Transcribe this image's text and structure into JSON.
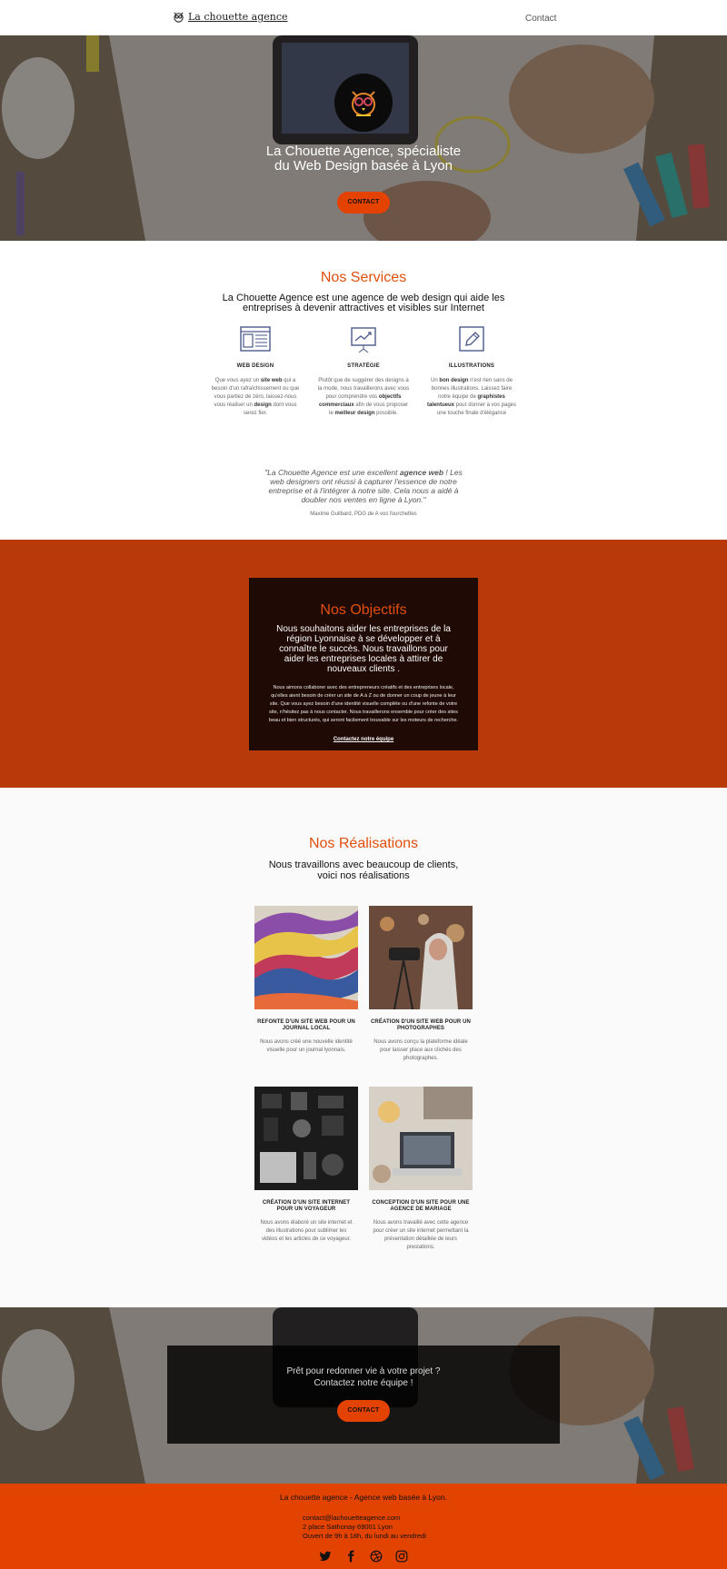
{
  "header": {
    "brand": "La chouette agence",
    "nav_contact": "Contact"
  },
  "hero": {
    "title": "La Chouette Agence, spécialiste du Web Design basée à Lyon",
    "button": "CONTACT"
  },
  "services": {
    "heading": "Nos Services",
    "lead": "La Chouette Agence est une agence de web design qui aide les entreprises à devenir attractives et visibles sur Internet",
    "items": [
      {
        "title": "WEB DESIGN",
        "icon": "web-design-icon"
      },
      {
        "title": "STRATÉGIE",
        "icon": "strategy-chart-icon"
      },
      {
        "title": "ILLUSTRATIONS",
        "icon": "pencil-icon"
      }
    ],
    "texts": {
      "web_a": "Que vous ayez un ",
      "web_b": "site web",
      "web_c": " qui a besoin d'un rafraîchissement ou que vous partiez de zéro, laissez-nous vous réaliser un ",
      "web_d": "design",
      "web_e": " dont vous serez fier.",
      "str_a": "Plutôt que de suggérer des designs à la mode, nous travaillerons avec vous pour comprendre vos ",
      "str_b": "objectifs commerciaux",
      "str_c": " afin de vous proposer le ",
      "str_d": "meilleur design",
      "str_e": " possible.",
      "ill_a": "Un ",
      "ill_b": "bon design",
      "ill_c": " n'est rien sans de bonnes illustrations. Laissez faire notre équipe de ",
      "ill_d": "graphistes talentueux",
      "ill_e": " pour donner à vos pages une touche finale d'élégance"
    }
  },
  "testimonial": {
    "q_a": "\"La Chouette Agence est une excellent ",
    "q_b": "agence web",
    "q_c": " ! Les web designers ont réussi à capturer l'essence de notre entreprise et à l'intégrer à notre site. Cela nous a aidé à doubler nos ventes en ligne à Lyon.\"",
    "author": "Maxime Guilbard, PDG de A vos fourchettes"
  },
  "objectifs": {
    "heading": "Nos Objectifs",
    "lead": "Nous souhaitons aider les entreprises de la région Lyonnaise à se développer et à connaître le succès. Nous travaillons pour aider les entreprises locales à attirer de nouveaux clients .",
    "text": "Nous aimons collaborer avec des entrepreneurs créatifs et des entreprises locale, qu'elles aient besoin de créer un site de A à Z ou de donner un coup de jeune à leur site. Que vous ayez besoin d'une identité visuelle complète ou d'une refonte de votre site, n'hésitez pas à nous contacter. Nous travaillerons ensemble pour créer des sites beau et bien structurés, qui seront facilement trouvable sur les moteurs de recherche.",
    "link": "Contactez notre équipe"
  },
  "realisations": {
    "heading": "Nos Réalisations",
    "lead": "Nous travaillons avec beaucoup de clients, voici nos réalisations",
    "projects": [
      {
        "title": "REFONTE D'UN SITE WEB POUR UN JOURNAL LOCAL",
        "text": "Nous avons créé une nouvelle identité visuelle pour un journal lyonnais."
      },
      {
        "title": "CRÉATION D'UN SITE WEB POUR UN PHOTOGRAPHES",
        "text": "Nous avons conçu la plateforme idéale pour laisser place aux clichés des photographes."
      },
      {
        "title": "CRÉATION D'UN SITE INTERNET POUR UN VOYAGEUR",
        "text": "Nous avons élaboré un site internet et des illustrations pour sublimer les vidéos et les articles de ce voyageur."
      },
      {
        "title": "CONCEPTION D'UN SITE POUR UNE AGENCE DE MARIAGE",
        "text": "Nous avons travaillé avec cette agence pour créer un site internet permettant la présentation détaillée de leurs prestations."
      }
    ]
  },
  "cta": {
    "line1": "Prêt pour redonner vie à votre projet ?",
    "line2": "Contactez notre équipe !",
    "button": "CONTACT"
  },
  "footer": {
    "title": "La chouette agence - Agence web basée à Lyon.",
    "email": "contact@lachouetteagence.com",
    "address": "2 place Sathonay 69001 Lyon",
    "hours": "Ouvert de 9h à 18h, du lundi au vendredi",
    "socials": [
      "twitter-icon",
      "facebook-icon",
      "dribbble-icon",
      "instagram-icon"
    ]
  },
  "colors": {
    "accent": "#e14f0e",
    "button": "#e44200",
    "objectifs_bg": "#b8390a",
    "objectifs_box": "#200a05",
    "footer_bg": "#e34300"
  }
}
